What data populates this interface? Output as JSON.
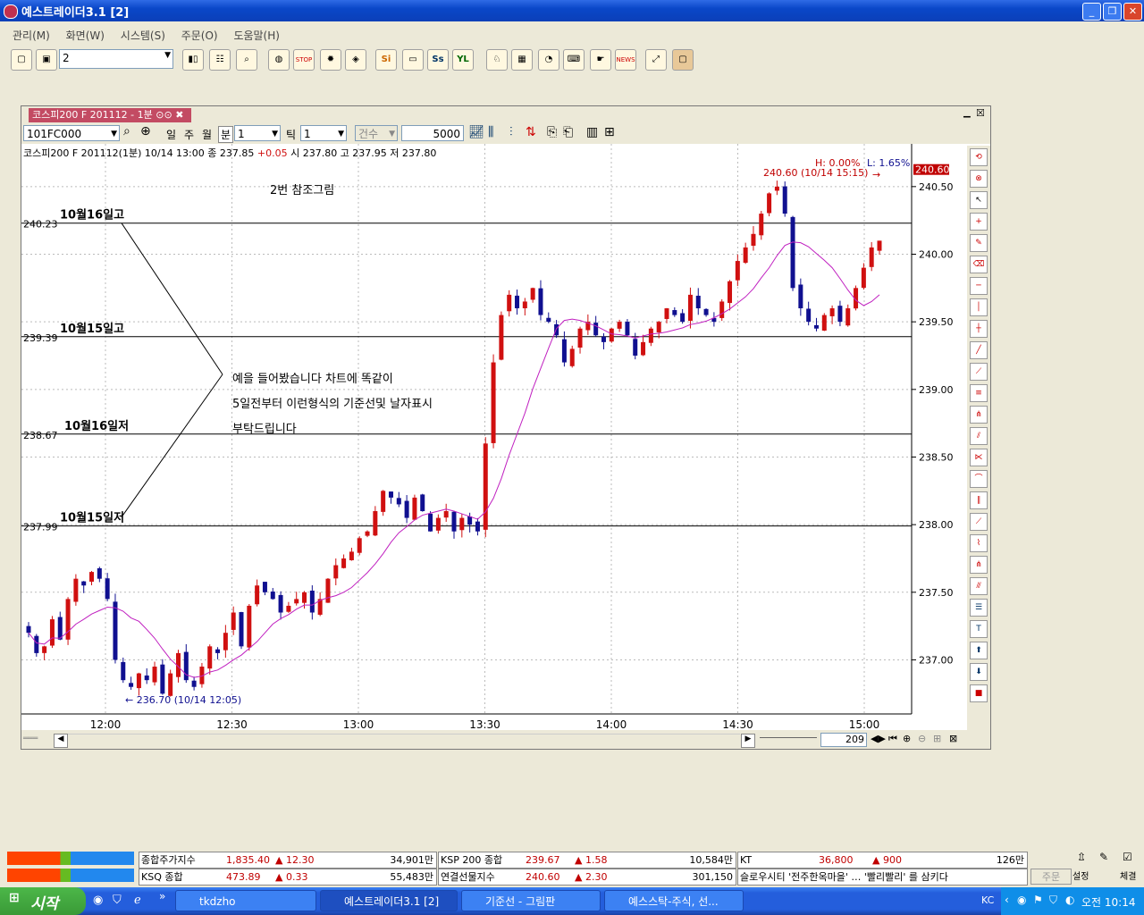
{
  "window": {
    "title": "예스트레이더3.1  [2]",
    "min_icon": "minimize-icon",
    "max_icon": "maximize-icon",
    "close_icon": "close-icon"
  },
  "menu": [
    "관리(M)",
    "화면(W)",
    "시스템(S)",
    "주문(O)",
    "도움말(H)"
  ],
  "toolbar": {
    "combo_value": "2",
    "stop_label": "STOP",
    "si_label": "Si",
    "ss_label": "Ss",
    "yl_label": "YL",
    "news_label": "NEWS"
  },
  "chart_window": {
    "tab_label": "코스피200 F 201112 - 1분",
    "code_value": "101FC000",
    "periods": [
      "일",
      "주",
      "월",
      "분"
    ],
    "interval_value": "1",
    "tick_label": "틱",
    "tick_value": "1",
    "count_label": "건수",
    "count_value": "5000",
    "info": {
      "prefix": "코스피200 F 201112(1분) 10/14 13:00  종 237.85",
      "change": "+0.05",
      "rest": "  시 237.80 고 237.95 저 237.80"
    },
    "hl": {
      "high": "H: 0.00%",
      "low": "L: 1.65%"
    },
    "max_label": "240.60 (10/14 15:15)",
    "min_label": "← 236.70 (10/14 12:05)",
    "last_price_tag": "240.60",
    "zoom_value": "209"
  },
  "annotations": {
    "title": "2번 참조그림",
    "lines": [
      {
        "level": "240.23",
        "text": "10월16일고"
      },
      {
        "level": "239.39",
        "text": "10월15일고"
      },
      {
        "level": "238.67",
        "text": "10월16일저"
      },
      {
        "level": "237.99",
        "text": "10월15일저"
      }
    ],
    "message": [
      "예을 들어봤습니다 차트에 똑같이",
      "5일전부터 이런형식의 기준선및 날자표시",
      "부탁드립니다"
    ]
  },
  "chart_data": {
    "type": "candlestick",
    "title": "",
    "y_ticks": [
      "240.50",
      "240.00",
      "239.50",
      "239.00",
      "238.50",
      "238.00",
      "237.50",
      "237.00"
    ],
    "x_ticks": [
      "12:00",
      "12:30",
      "13:00",
      "13:30",
      "14:00",
      "14:30",
      "15:00"
    ],
    "ylim": [
      236.6,
      240.75
    ],
    "horizontal_lines": [
      240.23,
      239.39,
      238.67,
      237.99
    ],
    "series": [
      {
        "name": "",
        "close_path": [
          237.2,
          237.05,
          237.1,
          237.3,
          237.15,
          237.45,
          237.6,
          237.55,
          237.65,
          237.6,
          237.45,
          237.0,
          236.85,
          236.8,
          236.9,
          236.85,
          236.95,
          236.75,
          236.9,
          237.05,
          236.85,
          236.8,
          236.95,
          237.1,
          237.05,
          237.2,
          237.35,
          237.1,
          237.4,
          237.55,
          237.5,
          237.45,
          237.35,
          237.4,
          237.45,
          237.5,
          237.35,
          237.45,
          237.6,
          237.7,
          237.75,
          237.8,
          237.9,
          237.95,
          238.1,
          238.25,
          238.2,
          238.15,
          238.05,
          238.2,
          238.1,
          237.95,
          238.05,
          238.1,
          237.95,
          238.05,
          238.0,
          237.95,
          238.6,
          239.2,
          239.55,
          239.7,
          239.6,
          239.65,
          239.75,
          239.55,
          239.5,
          239.4,
          239.2,
          239.3,
          239.45,
          239.5,
          239.4,
          239.35,
          239.45,
          239.5,
          239.4,
          239.25,
          239.35,
          239.45,
          239.5,
          239.6,
          239.55,
          239.5,
          239.7,
          239.6,
          239.55,
          239.5,
          239.65,
          239.8,
          239.95,
          240.05,
          240.15,
          240.3,
          240.45,
          240.5,
          240.3,
          239.75,
          239.6,
          239.5,
          239.45,
          239.55,
          239.6,
          239.5,
          239.6,
          239.75,
          239.9,
          240.05,
          240.1
        ]
      }
    ]
  },
  "ticker": {
    "row1": [
      {
        "name": "종합주가지수",
        "value": "1,835.40",
        "change": "▲ 12.30",
        "vol": "34,901만"
      },
      {
        "name": "KSP 200 종합",
        "value": "239.67",
        "change": "▲ 1.58",
        "vol": "10,584만"
      },
      {
        "name": "KT",
        "value": "36,800",
        "change": "▲ 900",
        "vol": "126만"
      }
    ],
    "row2": [
      {
        "name": "KSQ 종합",
        "value": "473.89",
        "change": "▲ 0.33",
        "vol": "55,483만"
      },
      {
        "name": "연결선물지수",
        "value": "240.60",
        "change": "▲ 2.30",
        "vol": "301,150"
      },
      {
        "name": "슬로우시티  '전주한옥마을' … '빨리빨리' 를 삼키다",
        "value": "",
        "change": "",
        "vol": ""
      }
    ],
    "buttons": [
      "주문",
      "설정",
      "체결"
    ]
  },
  "taskbar": {
    "start": "시작",
    "tasks": [
      "tkdzho",
      "예스트레이더3.1  [2]",
      "기준선 - 그림판",
      "예스스탁-주식, 선..."
    ],
    "tray_lang": "KC",
    "clock": "오전 10:14"
  },
  "colors": {
    "up": "#D01010",
    "down": "#101090",
    "ma": "#C020C0",
    "accent": "#245EDC"
  }
}
